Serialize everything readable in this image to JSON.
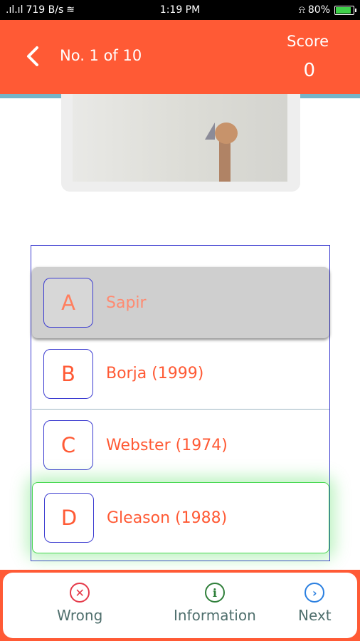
{
  "status_bar": {
    "signal": ".ıl.ıl",
    "speed": "719 B/s",
    "time": "1:19 PM",
    "battery": "80%"
  },
  "header": {
    "back_icon": "chevron-left-icon",
    "counter": "No. 1 of 10",
    "score_label": "Score",
    "score_value": "0"
  },
  "options": [
    {
      "letter": "A",
      "text": "Sapir"
    },
    {
      "letter": "B",
      "text": "Borja (1999)"
    },
    {
      "letter": "C",
      "text": "Webster (1974)"
    },
    {
      "letter": "D",
      "text": "Gleason (1988)"
    }
  ],
  "bottom_nav": {
    "wrong": {
      "label": "Wrong",
      "icon": "x-circle-icon",
      "glyph": "✕"
    },
    "information": {
      "label": "Information",
      "icon": "info-icon",
      "glyph": "i"
    },
    "next": {
      "label": "Next",
      "icon": "chevron-right-circle-icon",
      "glyph": "›"
    }
  },
  "colors": {
    "accent": "#ff5a35",
    "selected_border": "#46d84f",
    "option_border": "#3b3bd0"
  }
}
